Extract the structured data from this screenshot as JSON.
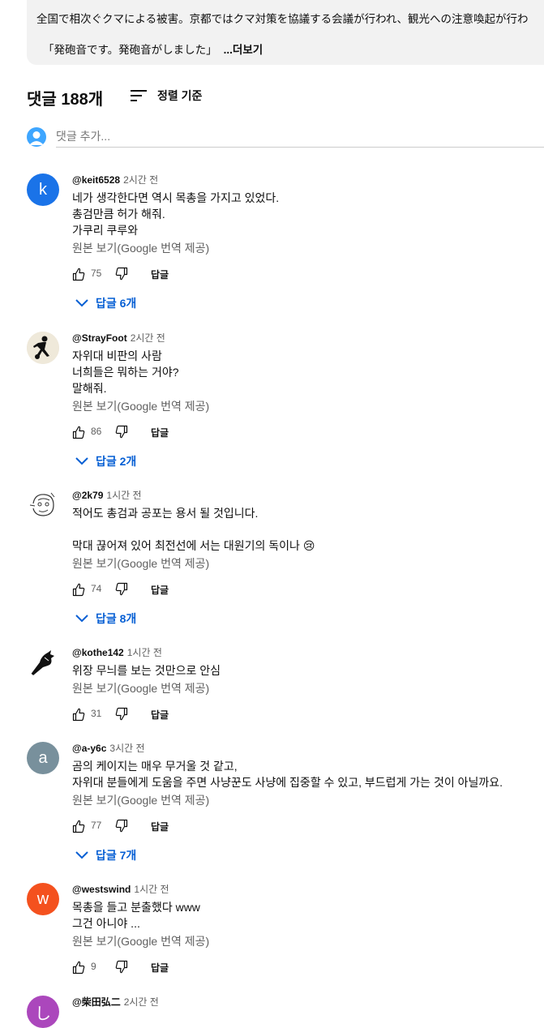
{
  "description": {
    "line1": "全国で相次ぐクマによる被害。京都ではクマ対策を協議する会議が行われ、観光への注意喚起が行わ",
    "line2": "「発砲音です。発砲音がしました」",
    "more_label": "...더보기"
  },
  "comments_header": {
    "count_title": "댓글 188개",
    "sort_label": "정렬 기준"
  },
  "add_comment": {
    "placeholder": "댓글 추가..."
  },
  "reply_label": "답글",
  "translate_label": "원본 보기(Google 번역 제공)",
  "comments": [
    {
      "avatar_letter": "k",
      "avatar_color": "#1a73e8",
      "author": "@keit6528",
      "time": "2시간 전",
      "text": "네가 생각한다면 역시 목총을 가지고 있었다.\n총검만큼 허가 해줘.\n가쿠리 쿠루와",
      "likes": "75",
      "replies": "답글 6개"
    },
    {
      "avatar_icon": "soccer-player-avatar",
      "author": "@StrayFoot",
      "time": "2시간 전",
      "text": "자위대 비판의 사람\n너희들은 뭐하는 거야?\n말해줘.",
      "likes": "86",
      "replies": "답글 2개"
    },
    {
      "avatar_icon": "sketch-face-avatar",
      "author": "@2k79",
      "time": "1시간 전",
      "text_line1": "적어도 총검과 공포는 용서 될 것입니다.",
      "text_line2": "막대 끊어져 있어 최전선에 서는 대원기의 독이나 😢",
      "likes": "74",
      "replies": "답글 8개"
    },
    {
      "avatar_icon": "animal-silhouette-avatar",
      "author": "@kothe142",
      "time": "1시간 전",
      "text": "위장 무늬를 보는 것만으로 안심",
      "likes": "31"
    },
    {
      "avatar_letter": "a",
      "avatar_color": "#78909c",
      "author": "@a-y6c",
      "time": "3시간 전",
      "text": "곰의 케이지는 매우 무거울 것 같고,\n자위대 분들에게 도움을 주면 사냥꾼도 사냥에 집중할 수 있고, 부드럽게 가는 것이 아닐까요.",
      "likes": "77",
      "replies": "답글 7개"
    },
    {
      "avatar_letter": "w",
      "avatar_color": "#f4511e",
      "author": "@westswind",
      "time": "1시간 전",
      "text": "목총을 들고 분출했다 www\n그건 아니야 ...",
      "likes": "9"
    },
    {
      "avatar_letter": "し",
      "avatar_color": "#ab47bc",
      "author": "@柴田弘二",
      "time": "2시간 전"
    }
  ]
}
